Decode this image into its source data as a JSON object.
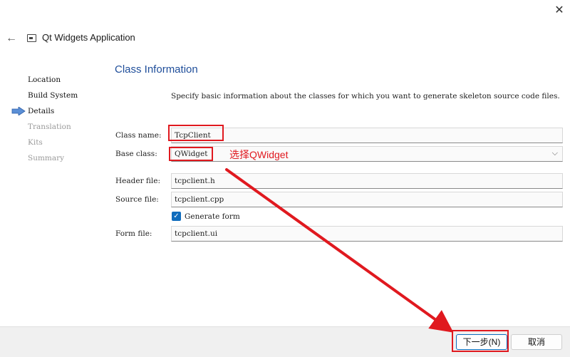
{
  "window": {
    "title": "Qt Widgets Application",
    "close_glyph": "✕",
    "back_glyph": "←"
  },
  "nav": {
    "items": [
      {
        "label": "Location",
        "state": "normal"
      },
      {
        "label": "Build System",
        "state": "normal"
      },
      {
        "label": "Details",
        "state": "current"
      },
      {
        "label": "Translation",
        "state": "disabled"
      },
      {
        "label": "Kits",
        "state": "disabled"
      },
      {
        "label": "Summary",
        "state": "disabled"
      }
    ]
  },
  "page": {
    "title": "Class Information",
    "description": "Specify basic information about the classes for which you want to generate skeleton source code files."
  },
  "form": {
    "class_name_label": "Class name:",
    "class_name_value": "TcpClient",
    "base_class_label": "Base class:",
    "base_class_value": "QWidget",
    "header_file_label": "Header file:",
    "header_file_value": "tcpclient.h",
    "source_file_label": "Source file:",
    "source_file_value": "tcpclient.cpp",
    "generate_form_label": "Generate form",
    "generate_form_checked": true,
    "form_file_label": "Form file:",
    "form_file_value": "tcpclient.ui"
  },
  "buttons": {
    "next_label": "下一步(N)",
    "cancel_label": "取消"
  },
  "annotation": {
    "text": "选择QWidget",
    "color": "#e0191f"
  },
  "colors": {
    "accent": "#0f6cbd",
    "title": "#1f4e9a",
    "annotation_red": "#e0191f"
  }
}
